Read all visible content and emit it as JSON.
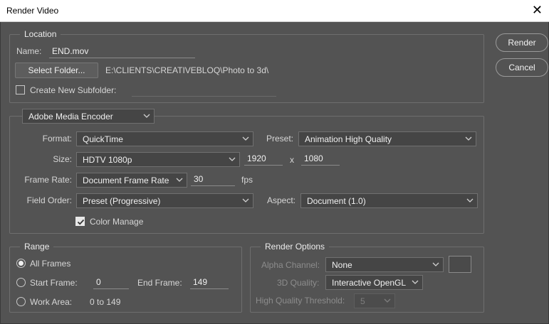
{
  "window": {
    "title": "Render Video",
    "close_glyph": "✕"
  },
  "actions": {
    "render_label": "Render",
    "cancel_label": "Cancel"
  },
  "location": {
    "legend": "Location",
    "name_label": "Name:",
    "name_value": "END.mov",
    "select_folder_label": "Select Folder...",
    "folder_path": "E:\\CLIENTS\\CREATIVEBLOQ\\Photo to 3d\\",
    "subfolder_label": "Create New Subfolder:",
    "subfolder_checked": false,
    "subfolder_value": ""
  },
  "encoder": {
    "selected": "Adobe Media Encoder",
    "format_label": "Format:",
    "format_value": "QuickTime",
    "preset_label": "Preset:",
    "preset_value": "Animation High Quality",
    "size_label": "Size:",
    "size_value": "HDTV 1080p",
    "width_value": "1920",
    "x_label": "x",
    "height_value": "1080",
    "framerate_label": "Frame Rate:",
    "framerate_value": "Document Frame Rate",
    "fps_value": "30",
    "fps_label": "fps",
    "fieldorder_label": "Field Order:",
    "fieldorder_value": "Preset (Progressive)",
    "aspect_label": "Aspect:",
    "aspect_value": "Document (1.0)",
    "color_manage_label": "Color Manage",
    "color_manage_checked": true
  },
  "range": {
    "legend": "Range",
    "all_frames_label": "All Frames",
    "start_frame_label": "Start Frame:",
    "start_frame_value": "0",
    "end_frame_label": "End Frame:",
    "end_frame_value": "149",
    "work_area_label": "Work Area:",
    "work_area_value": "0 to 149",
    "selected": "All Frames"
  },
  "render_options": {
    "legend": "Render Options",
    "alpha_label": "Alpha Channel:",
    "alpha_value": "None",
    "quality_label": "3D Quality:",
    "quality_value": "Interactive OpenGL",
    "hq_threshold_label": "High Quality Threshold:",
    "hq_threshold_value": "5"
  },
  "colors": {
    "background": "#535353",
    "titlebar": "#ffffff",
    "border": "#6e6e6e"
  },
  "icons": {
    "dropdown": "chevron-down-icon",
    "check": "check-icon",
    "close": "close-icon"
  }
}
